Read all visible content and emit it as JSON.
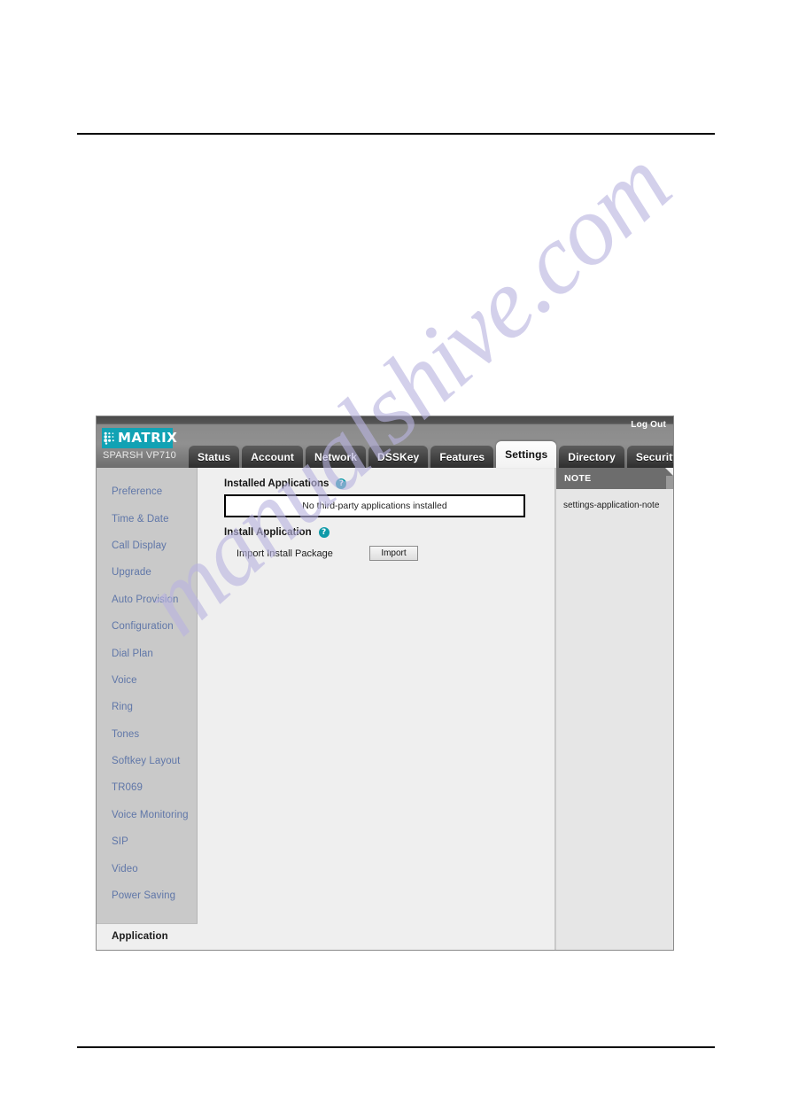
{
  "device": {
    "brand": "MATRIX",
    "model": "SPARSH VP710",
    "logo_color": "#11a2b4"
  },
  "header": {
    "logout_label": "Log Out"
  },
  "tabs": [
    {
      "label": "Status",
      "active": false
    },
    {
      "label": "Account",
      "active": false
    },
    {
      "label": "Network",
      "active": false
    },
    {
      "label": "DSSKey",
      "active": false
    },
    {
      "label": "Features",
      "active": false
    },
    {
      "label": "Settings",
      "active": true
    },
    {
      "label": "Directory",
      "active": false
    },
    {
      "label": "Security",
      "active": false
    }
  ],
  "sidebar": {
    "items": [
      {
        "label": "Preference"
      },
      {
        "label": "Time & Date"
      },
      {
        "label": "Call Display"
      },
      {
        "label": "Upgrade"
      },
      {
        "label": "Auto Provision"
      },
      {
        "label": "Configuration"
      },
      {
        "label": "Dial Plan"
      },
      {
        "label": "Voice"
      },
      {
        "label": "Ring"
      },
      {
        "label": "Tones"
      },
      {
        "label": "Softkey Layout"
      },
      {
        "label": "TR069"
      },
      {
        "label": "Voice Monitoring"
      },
      {
        "label": "SIP"
      },
      {
        "label": "Video"
      },
      {
        "label": "Power Saving"
      }
    ],
    "active_item": {
      "label": "Application"
    }
  },
  "main": {
    "installed_applications": {
      "title": "Installed Applications",
      "help_glyph": "?",
      "empty_message": "No third-party applications installed"
    },
    "install_application": {
      "title": "Install Application",
      "help_glyph": "?",
      "import_label": "Import Install Package",
      "import_button": "Import"
    }
  },
  "note": {
    "header": "NOTE",
    "body": "settings-application-note"
  },
  "watermark": {
    "text": "manualshive.com",
    "color": "#b9b4e0"
  }
}
